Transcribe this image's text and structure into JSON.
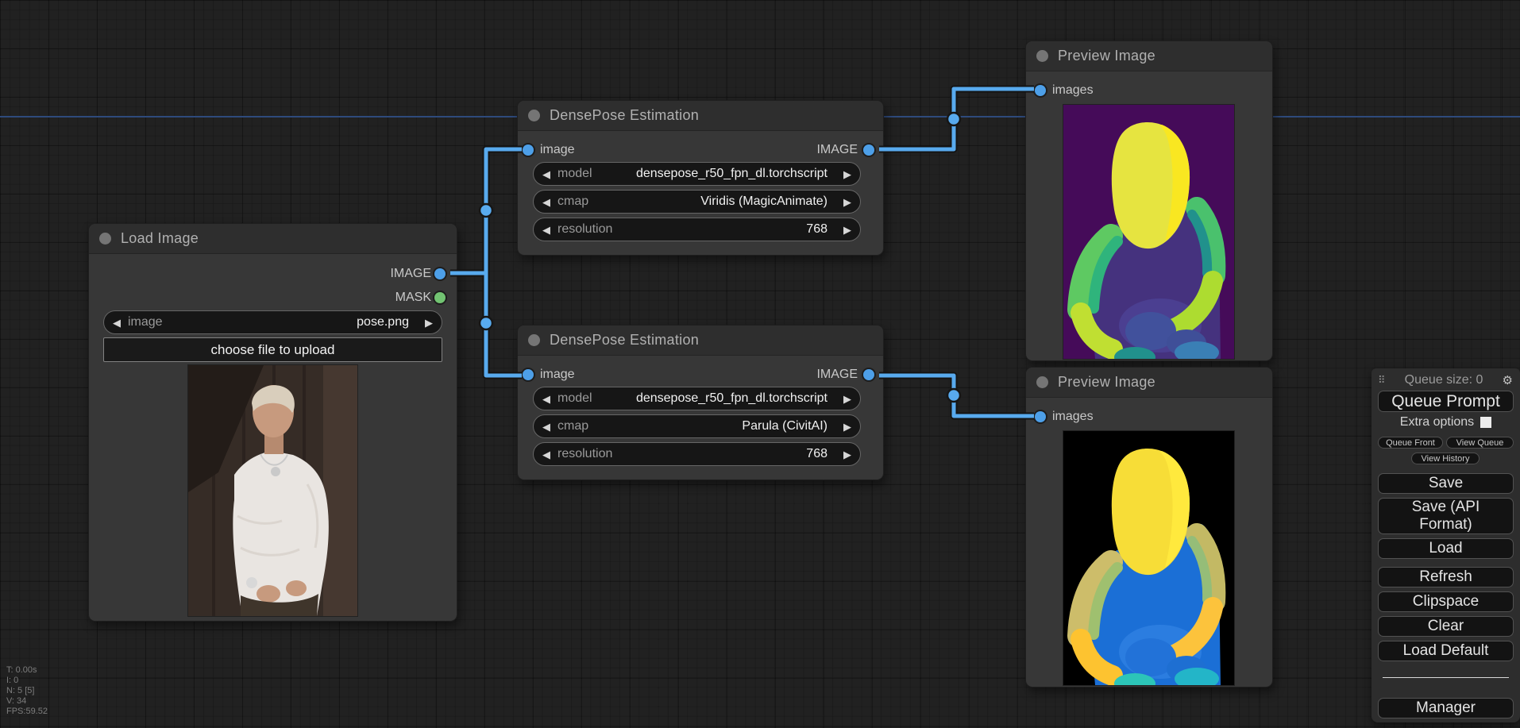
{
  "icons": {
    "left": "◀",
    "right": "▶",
    "gear": "⚙",
    "drag_handle": "⠿"
  },
  "colors": {
    "link": "#58aaee",
    "dim_link": "#2e4a7c",
    "image_port": "#4d9fe8",
    "mask_port": "#72c372"
  },
  "stats": {
    "lines": [
      "T: 0.00s",
      "I: 0",
      "N: 5 [5]",
      "V: 34",
      "FPS:59.52"
    ]
  },
  "load_image": {
    "title": "Load Image",
    "output_image": "IMAGE",
    "output_mask": "MASK",
    "widget": {
      "label": "image",
      "value": "pose.png"
    },
    "upload_button": "choose file to upload",
    "photo": {
      "bg": "#362c26",
      "bg_dark": "#231c18",
      "bg_light": "#463830",
      "plank": "#2b221e",
      "shirt": "#e9e5e1",
      "shirt_shadow": "#d4cec8",
      "skin": "#c79a7e",
      "skin_dark": "#b68a6f",
      "hair": "#d9cebc",
      "pants": "#3f352b",
      "necklace": "#c9c9c9",
      "watch": "#d8d8d8"
    }
  },
  "densepose_1": {
    "title": "DensePose Estimation",
    "input": "image",
    "output": "IMAGE",
    "widgets": [
      {
        "label": "model",
        "value": "densepose_r50_fpn_dl.torchscript"
      },
      {
        "label": "cmap",
        "value": "Viridis (MagicAnimate)"
      },
      {
        "label": "resolution",
        "value": "768"
      }
    ]
  },
  "densepose_2": {
    "title": "DensePose Estimation",
    "input": "image",
    "output": "IMAGE",
    "widgets": [
      {
        "label": "model",
        "value": "densepose_r50_fpn_dl.torchscript"
      },
      {
        "label": "cmap",
        "value": "Parula (CivitAI)"
      },
      {
        "label": "resolution",
        "value": "768"
      }
    ]
  },
  "preview_1": {
    "title": "Preview Image",
    "input": "images",
    "palette": {
      "bg": "#450b59",
      "head": "#e6e440",
      "head_hi": "#f9e721",
      "torso": "#45327e",
      "belly": "#4b3f91",
      "arm_outer_l": "#5ec962",
      "arm_inner_l": "#2fb47c",
      "arm_outer_r": "#4ac16d",
      "arm_inner_r": "#21918c",
      "forearm_l": "#c0df32",
      "forearm_r": "#addc30",
      "hand_l": "#41519c",
      "hand_r": "#3f4f98",
      "patch_a": "#21918c",
      "patch_b": "#3a7fb5"
    }
  },
  "preview_2": {
    "title": "Preview Image",
    "input": "images",
    "palette": {
      "bg": "#000000",
      "head": "#f7dd37",
      "head_hi": "#ffe93d",
      "torso": "#1b6fd6",
      "belly": "#2b7de0",
      "arm_outer_l": "#cdbd6a",
      "arm_inner_l": "#9fc06f",
      "arm_outer_r": "#c3b964",
      "arm_inner_r": "#95bd78",
      "forearm_l": "#fdc330",
      "forearm_r": "#fcc33c",
      "hand_l": "#2272d8",
      "hand_r": "#1e6fd2",
      "patch_a": "#2cc5b8",
      "patch_b": "#23b5c8"
    }
  },
  "sidebar": {
    "queue_size": "Queue size: 0",
    "queue_prompt": "Queue Prompt",
    "extra_options": "Extra options",
    "queue_front": "Queue Front",
    "view_queue": "View Queue",
    "view_history": "View History",
    "save": "Save",
    "save_api": "Save (API Format)",
    "load": "Load",
    "refresh": "Refresh",
    "clipspace": "Clipspace",
    "clear": "Clear",
    "load_default": "Load Default",
    "manager": "Manager"
  }
}
